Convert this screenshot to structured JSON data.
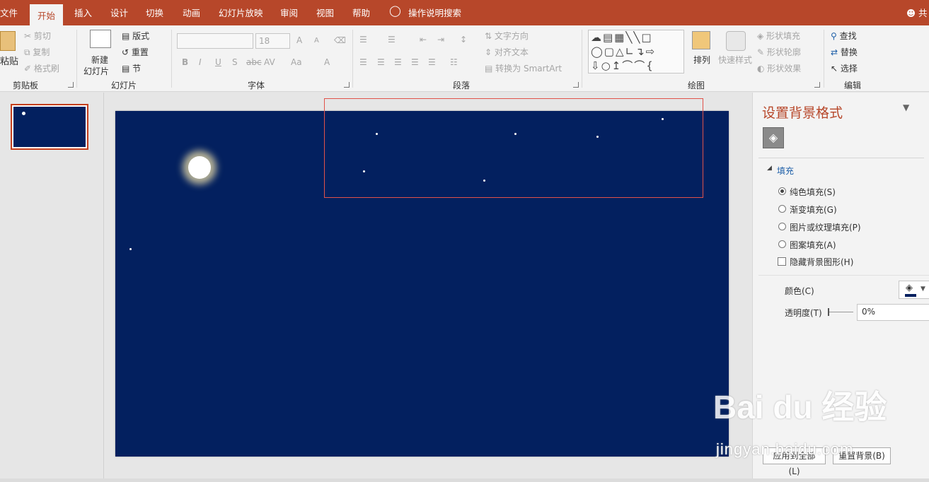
{
  "tabs": [
    {
      "label": "文件"
    },
    {
      "label": "开始"
    },
    {
      "label": "插入"
    },
    {
      "label": "设计"
    },
    {
      "label": "切换"
    },
    {
      "label": "动画"
    },
    {
      "label": "幻灯片放映"
    },
    {
      "label": "审阅"
    },
    {
      "label": "视图"
    },
    {
      "label": "帮助"
    }
  ],
  "tell_me": "操作说明搜索",
  "share_label": "共",
  "clipboard": {
    "paste": "粘贴",
    "cut": "剪切",
    "copy": "复制",
    "painter": "格式刷",
    "group": "剪贴板"
  },
  "slides": {
    "new_line1": "新建",
    "new_line2": "幻灯片",
    "layout": "版式",
    "reset": "重置",
    "section": "节",
    "group": "幻灯片"
  },
  "font": {
    "size": "18",
    "group": "字体",
    "bold": "B",
    "italic": "I",
    "underline": "U",
    "shadow": "S",
    "strike": "abc",
    "spacing": "AV",
    "case": "Aa",
    "color": "A",
    "grow": "A",
    "shrink": "A"
  },
  "paragraph": {
    "text_direction": "文字方向",
    "align_text": "对齐文本",
    "smartart": "转换为 SmartArt",
    "group": "段落"
  },
  "drawing": {
    "arrange": "排列",
    "quick_styles": "快速样式",
    "shape_fill": "形状填充",
    "shape_outline": "形状轮廓",
    "shape_effects": "形状效果",
    "group": "绘图"
  },
  "editing": {
    "find": "查找",
    "replace": "替换",
    "select": "选择",
    "group": "编辑"
  },
  "pane": {
    "title": "设置背景格式",
    "section": "填充",
    "options": [
      {
        "label": "纯色填充(S)",
        "selected": true
      },
      {
        "label": "渐变填充(G)",
        "selected": false
      },
      {
        "label": "图片或纹理填充(P)",
        "selected": false
      },
      {
        "label": "图案填充(A)",
        "selected": false
      }
    ],
    "hide_graphics": "隐藏背景图形(H)",
    "color_label": "颜色(C)",
    "transparency_label": "透明度(T)",
    "transparency_value": "0%",
    "apply_all": "应用到全部(L)",
    "reset_bg": "重置背景(B)"
  },
  "colors": {
    "accent": "#b7472a",
    "slide_bg": "#03205f"
  },
  "watermark": {
    "brand": "Bai du 经验",
    "url": "jingyan.baidu.com"
  }
}
